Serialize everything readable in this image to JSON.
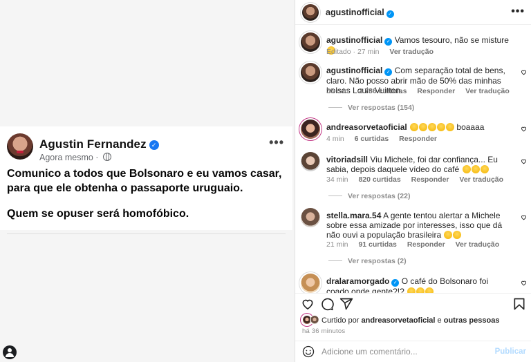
{
  "facebook_post": {
    "author": "Agustin Fernandez",
    "time": "Agora mesmo",
    "separator": "·",
    "paragraph_1": "Comunico a todos que Bolsonaro e eu vamos casar, para que ele obtenha o passaporte uruguaio.",
    "paragraph_2": "Quem se opuser será homofóbico.",
    "more": "•••"
  },
  "instagram": {
    "header": {
      "username": "agustinofficial",
      "more": "•••"
    },
    "comments": [
      {
        "username": "agustinofficial",
        "text": "Vamos tesouro, não se misture",
        "meta": [
          "Editado · 27 min",
          "Ver tradução"
        ]
      },
      {
        "username": "agustinofficial",
        "text": "Com separação total de bens, claro. Não posso abrir mão de 50% das minhas bolsas Louis Vuitton.",
        "meta": [
          "35 min",
          "2.786 curtidas",
          "Responder",
          "Ver tradução"
        ],
        "replies": "Ver respostas (154)"
      },
      {
        "username": "andreasorvetaoficial",
        "text": "boaaaa",
        "meta": [
          "4 min",
          "6 curtidas",
          "Responder"
        ]
      },
      {
        "username": "vitoriadsill",
        "text": "Viu Michele, foi dar confiança... Eu sabia, depois daquele vídeo do café",
        "meta": [
          "34 min",
          "820 curtidas",
          "Responder",
          "Ver tradução"
        ],
        "replies": "Ver respostas (22)"
      },
      {
        "username": "stella.mara.54",
        "text": "A gente tentou alertar a Michele sobre essa amizade por interesses, isso que dá não ouvi a população brasileira",
        "meta": [
          "21 min",
          "91 curtidas",
          "Responder",
          "Ver tradução"
        ],
        "replies": "Ver respostas (2)"
      },
      {
        "username": "dralaramorgado",
        "text": "O café do Bolsonaro foi coado onde gente?!?"
      }
    ],
    "likes": {
      "prefix": "Curtido por",
      "user": "andreasorvetaoficial",
      "conj": "e",
      "others": "outras pessoas"
    },
    "time_ago": "HÁ 36 MINUTOS",
    "time_ago_display": "há 36 minutos",
    "comment_placeholder": "Adicione um comentário...",
    "publish": "Publicar"
  },
  "icons": [
    "verified-icon",
    "globe-icon",
    "more-icon",
    "heart-icon",
    "comment-icon",
    "share-icon",
    "bookmark-icon",
    "smiley-icon",
    "user-circle-icon"
  ],
  "colors": {
    "verified": "#0095f6",
    "fb_verified": "#1877f2",
    "publish_disabled": "#b3dbff",
    "muted": "#8e8e8e"
  }
}
